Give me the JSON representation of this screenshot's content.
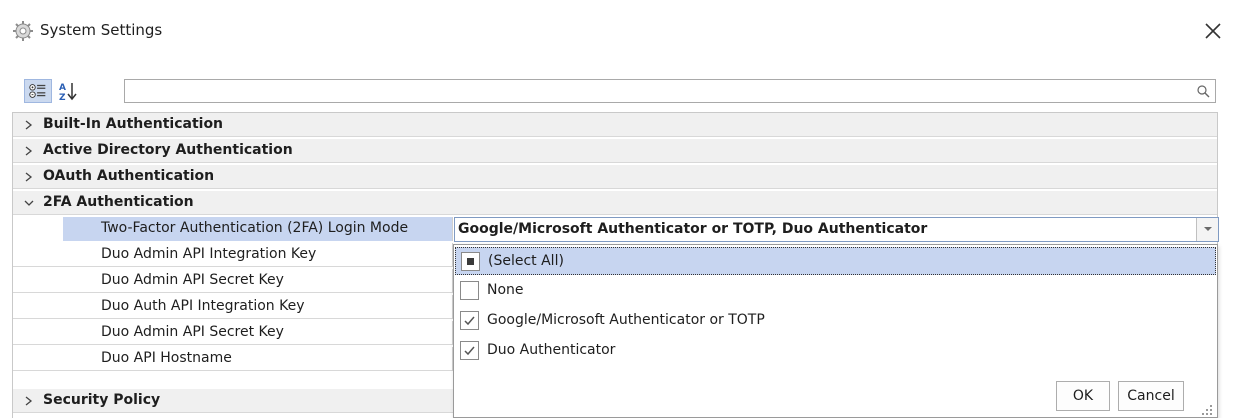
{
  "window": {
    "title": "System Settings",
    "close_icon": "close-icon",
    "app_icon": "gear-icon"
  },
  "toolbar": {
    "categorized_icon": "categorized-view-icon",
    "alphabetical_icon": "sort-az-icon",
    "search_value": "",
    "search_placeholder": "",
    "search_icon": "search-icon"
  },
  "grid": {
    "categories": [
      {
        "label": "Built-In Authentication",
        "expanded": false
      },
      {
        "label": "Active Directory Authentication",
        "expanded": false
      },
      {
        "label": "OAuth Authentication",
        "expanded": false
      },
      {
        "label": "2FA Authentication",
        "expanded": true
      },
      {
        "label": "Security Policy",
        "expanded": false
      }
    ],
    "properties": [
      {
        "name": "Two-Factor Authentication (2FA) Login Mode",
        "value": "Google/Microsoft Authenticator or TOTP, Duo Authenticator",
        "selected": true
      },
      {
        "name": "Duo Admin API Integration Key",
        "value": ""
      },
      {
        "name": "Duo Admin API Secret Key",
        "value": ""
      },
      {
        "name": "Duo Auth API Integration Key",
        "value": ""
      },
      {
        "name": "Duo Admin API Secret Key",
        "value": ""
      },
      {
        "name": "Duo API Hostname",
        "value": ""
      }
    ]
  },
  "dropdown": {
    "options": [
      {
        "label": "(Select All)",
        "state": "indeterminate"
      },
      {
        "label": "None",
        "state": "unchecked"
      },
      {
        "label": "Google/Microsoft Authenticator or TOTP",
        "state": "checked"
      },
      {
        "label": "Duo Authenticator",
        "state": "checked"
      }
    ],
    "ok_label": "OK",
    "cancel_label": "Cancel"
  },
  "colors": {
    "selection": "#c7d5f0",
    "category_bg": "#f0f0f0"
  }
}
